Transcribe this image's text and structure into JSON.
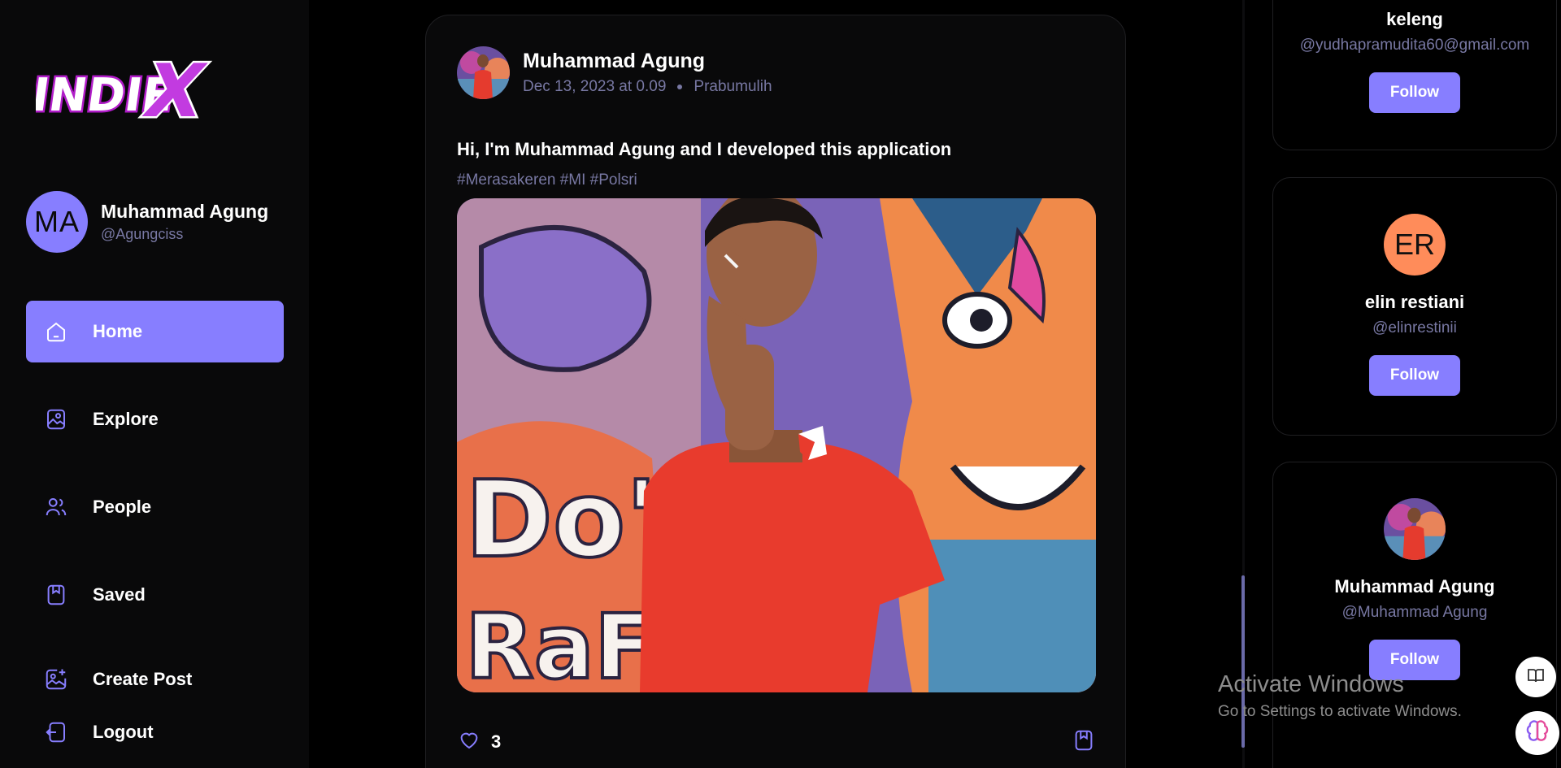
{
  "app": {
    "logo_text": "INDIE X"
  },
  "profile": {
    "initials": "MA",
    "name": "Muhammad Agung",
    "handle": "@Agungciss"
  },
  "nav": {
    "items": [
      {
        "label": "Home",
        "icon": "home-icon",
        "active": true
      },
      {
        "label": "Explore",
        "icon": "gallery-icon",
        "active": false
      },
      {
        "label": "People",
        "icon": "people-icon",
        "active": false
      },
      {
        "label": "Saved",
        "icon": "bookmark-icon",
        "active": false
      }
    ],
    "bottom": [
      {
        "label": "Create Post",
        "icon": "image-add-icon"
      },
      {
        "label": "Logout",
        "icon": "logout-icon"
      }
    ]
  },
  "post": {
    "author": "Muhammad Agung",
    "date": "Dec 13, 2023 at 0.09",
    "location": "Prabumulih",
    "caption": "Hi, I'm Muhammad Agung and I developed this application",
    "tags": "#Merasakeren #MI #Polsri",
    "likes": "3"
  },
  "creators": [
    {
      "name": "keleng",
      "handle": "@yudhapramudita60@gmail.com",
      "button": "Follow"
    },
    {
      "name": "elin restiani",
      "handle": "@elinrestinii",
      "initials": "ER",
      "button": "Follow"
    },
    {
      "name": "Muhammad Agung",
      "handle": "@Muhammad Agung",
      "button": "Follow"
    }
  ],
  "watermark": {
    "title": "Activate Windows",
    "subtitle": "Go to Settings to activate Windows."
  },
  "colors": {
    "primary": "#877eff",
    "muted": "#7878a3",
    "background": "#000000",
    "panel": "#09090a",
    "er_avatar": "#ff8c5a"
  }
}
